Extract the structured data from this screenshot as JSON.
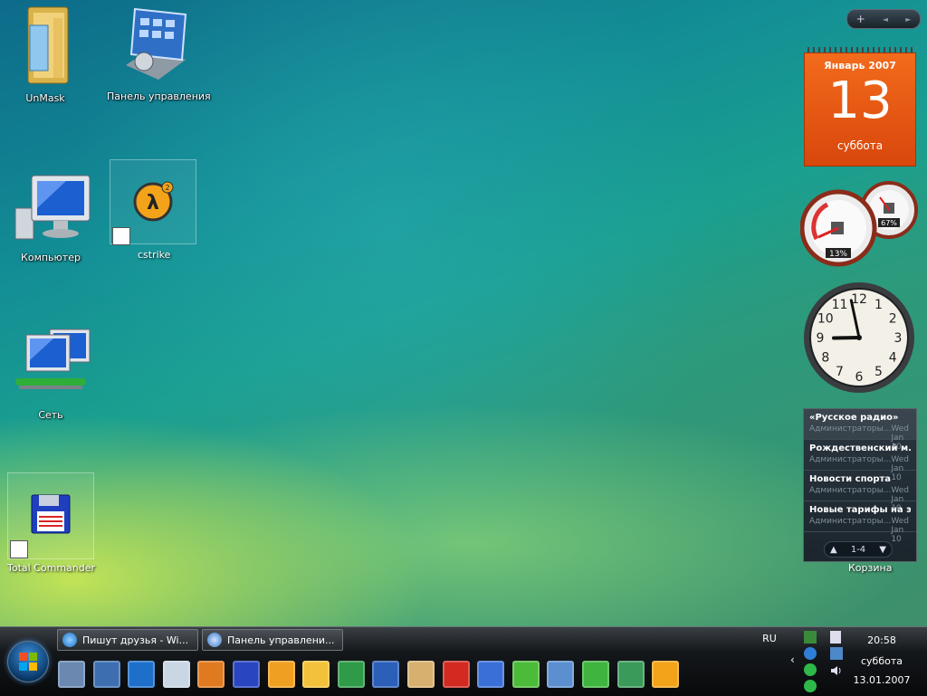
{
  "desktop_icons": [
    {
      "name": "UnMask",
      "icon": "folder-icon"
    },
    {
      "name": "Панель управления",
      "icon": "control-panel-icon"
    },
    {
      "name": "Компьютер",
      "icon": "computer-icon"
    },
    {
      "name": "cstrike",
      "icon": "half-life-icon"
    },
    {
      "name": "Сеть",
      "icon": "network-icon"
    },
    {
      "name": "Total Commander",
      "icon": "floppy-disk-icon"
    }
  ],
  "sidebar": {
    "controls": {
      "add": "+",
      "prev": "◄",
      "next": "►"
    },
    "calendar": {
      "month_year": "Январь 2007",
      "day": "13",
      "weekday": "суббота"
    },
    "meters": {
      "cpu": "13%",
      "memory": "67%"
    },
    "clock": {
      "numerals": [
        "12",
        "1",
        "2",
        "3",
        "4",
        "5",
        "6",
        "7",
        "8",
        "9",
        "10",
        "11"
      ],
      "hour": 20,
      "minute": 58
    },
    "feed": {
      "items": [
        {
          "title": "«Русское радио»",
          "author": "Администраторы...",
          "date": "Wed Jan 10"
        },
        {
          "title": "Рождественский м...",
          "author": "Администраторы...",
          "date": "Wed Jan 10"
        },
        {
          "title": "Новости спорта",
          "author": "Администраторы...",
          "date": "Wed Jan 10"
        },
        {
          "title": "Новые тарифы на э...",
          "author": "Администраторы...",
          "date": "Wed Jan 10"
        }
      ],
      "page": "1-4"
    },
    "recycle_label": "Корзина"
  },
  "taskbar": {
    "tasks": [
      {
        "label": "Пишут друзья - Wi..."
      },
      {
        "label": "Панель управлени..."
      }
    ],
    "quick_launch": [
      "show-desktop-icon",
      "switch-windows-icon",
      "internet-explorer-icon",
      "network-map-icon",
      "media-player-icon",
      "floppy-save-icon",
      "lightning-icon",
      "mail-icon",
      "excel-icon",
      "word-icon",
      "home-icon",
      "opera-icon",
      "feather-icon",
      "checkmark-icon",
      "network-computer-icon",
      "icq-icon",
      "messenger-icon",
      "half-life-icon"
    ],
    "language": "RU",
    "time": "20:58",
    "weekday": "суббота",
    "date": "13.01.2007"
  },
  "colors": {
    "calendar": "#e85a14",
    "accent": "#3f8fd8"
  }
}
